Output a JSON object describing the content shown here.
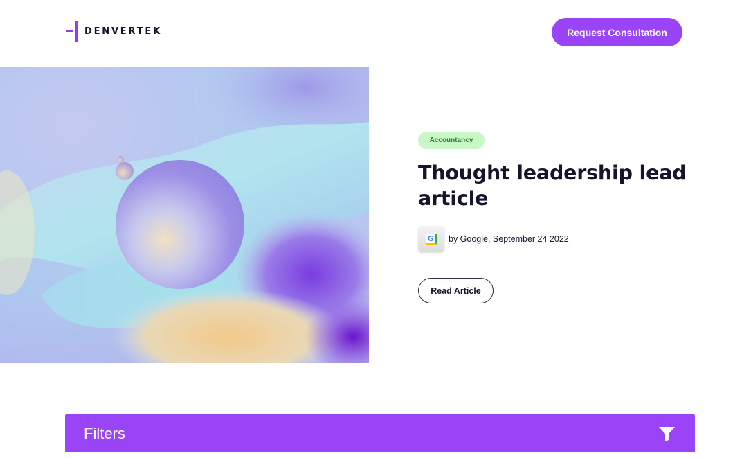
{
  "header": {
    "logo_text": "DENVERTEK",
    "cta_label": "Request Consultation"
  },
  "hero": {
    "image_description_icon": "abstract-3d-image",
    "tag": "Accountancy",
    "title": "Thought leadership lead article",
    "author_icon": "google-logo-icon",
    "byline": "by Google, September 24 2022",
    "read_button": "Read Article"
  },
  "filters": {
    "label": "Filters",
    "icon": "filter-icon"
  },
  "colors": {
    "accent": "#9945f7",
    "tag_bg": "#c9f7c6",
    "tag_text": "#1e8c2c",
    "text_dark": "#14142b"
  }
}
